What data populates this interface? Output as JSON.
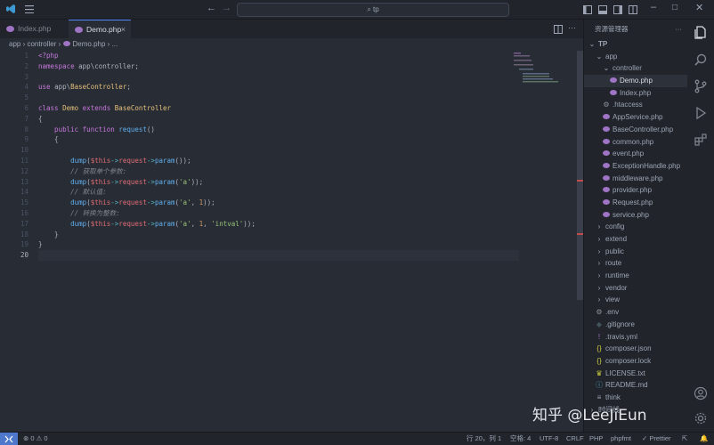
{
  "colors": {
    "keyword": "#c678dd",
    "function": "#61afef",
    "class": "#e5c07b",
    "variable": "#e06c75",
    "string": "#98c379",
    "number": "#d19a66",
    "comment": "#7f848e",
    "operator": "#56b6c2",
    "plain": "#abb2bf",
    "accent": "#528bff",
    "php_icon": "#a074c4"
  },
  "titlebar": {
    "search": "tp"
  },
  "tabs": [
    {
      "label": "Index.php"
    },
    {
      "label": "Demo.php",
      "close": "×"
    }
  ],
  "breadcrumb": {
    "segments": [
      "app",
      "controller",
      "Demo.php",
      "..."
    ]
  },
  "editor": {
    "line_numbers": [
      "1",
      "2",
      "3",
      "4",
      "5",
      "6",
      "7",
      "8",
      "9",
      "10",
      "11",
      "12",
      "13",
      "14",
      "15",
      "16",
      "17",
      "18",
      "19",
      "20"
    ],
    "active_line": 20,
    "lines": [
      [
        {
          "t": "<?php",
          "c": "keyword"
        }
      ],
      [
        {
          "t": "namespace ",
          "c": "keyword"
        },
        {
          "t": "app\\controller",
          "c": "plain"
        },
        {
          "t": ";",
          "c": "plain"
        }
      ],
      [],
      [
        {
          "t": "use ",
          "c": "keyword"
        },
        {
          "t": "app\\",
          "c": "plain"
        },
        {
          "t": "BaseController",
          "c": "class"
        },
        {
          "t": ";",
          "c": "plain"
        }
      ],
      [],
      [
        {
          "t": "class ",
          "c": "keyword"
        },
        {
          "t": "Demo ",
          "c": "class"
        },
        {
          "t": "extends ",
          "c": "keyword"
        },
        {
          "t": "BaseController",
          "c": "class"
        }
      ],
      [
        {
          "t": "{",
          "c": "plain"
        }
      ],
      [
        {
          "t": "    public ",
          "c": "keyword"
        },
        {
          "t": "function ",
          "c": "keyword"
        },
        {
          "t": "request",
          "c": "function"
        },
        {
          "t": "()",
          "c": "plain"
        }
      ],
      [
        {
          "t": "    {",
          "c": "plain"
        }
      ],
      [],
      [
        {
          "t": "        ",
          "c": "plain"
        },
        {
          "t": "dump",
          "c": "function"
        },
        {
          "t": "(",
          "c": "plain"
        },
        {
          "t": "$this",
          "c": "variable"
        },
        {
          "t": "->",
          "c": "operator"
        },
        {
          "t": "request",
          "c": "variable"
        },
        {
          "t": "->",
          "c": "operator"
        },
        {
          "t": "param",
          "c": "function"
        },
        {
          "t": "());",
          "c": "plain"
        }
      ],
      [
        {
          "t": "        // 获取单个参数:",
          "c": "comment"
        }
      ],
      [
        {
          "t": "        ",
          "c": "plain"
        },
        {
          "t": "dump",
          "c": "function"
        },
        {
          "t": "(",
          "c": "plain"
        },
        {
          "t": "$this",
          "c": "variable"
        },
        {
          "t": "->",
          "c": "operator"
        },
        {
          "t": "request",
          "c": "variable"
        },
        {
          "t": "->",
          "c": "operator"
        },
        {
          "t": "param",
          "c": "function"
        },
        {
          "t": "(",
          "c": "plain"
        },
        {
          "t": "'a'",
          "c": "string"
        },
        {
          "t": "));",
          "c": "plain"
        }
      ],
      [
        {
          "t": "        // 默认值:",
          "c": "comment"
        }
      ],
      [
        {
          "t": "        ",
          "c": "plain"
        },
        {
          "t": "dump",
          "c": "function"
        },
        {
          "t": "(",
          "c": "plain"
        },
        {
          "t": "$this",
          "c": "variable"
        },
        {
          "t": "->",
          "c": "operator"
        },
        {
          "t": "request",
          "c": "variable"
        },
        {
          "t": "->",
          "c": "operator"
        },
        {
          "t": "param",
          "c": "function"
        },
        {
          "t": "(",
          "c": "plain"
        },
        {
          "t": "'a'",
          "c": "string"
        },
        {
          "t": ", ",
          "c": "plain"
        },
        {
          "t": "1",
          "c": "number"
        },
        {
          "t": "));",
          "c": "plain"
        }
      ],
      [
        {
          "t": "        // 转换为整数:",
          "c": "comment"
        }
      ],
      [
        {
          "t": "        ",
          "c": "plain"
        },
        {
          "t": "dump",
          "c": "function"
        },
        {
          "t": "(",
          "c": "plain"
        },
        {
          "t": "$this",
          "c": "variable"
        },
        {
          "t": "->",
          "c": "operator"
        },
        {
          "t": "request",
          "c": "variable"
        },
        {
          "t": "->",
          "c": "operator"
        },
        {
          "t": "param",
          "c": "function"
        },
        {
          "t": "(",
          "c": "plain"
        },
        {
          "t": "'a'",
          "c": "string"
        },
        {
          "t": ", ",
          "c": "plain"
        },
        {
          "t": "1",
          "c": "number"
        },
        {
          "t": ", ",
          "c": "plain"
        },
        {
          "t": "'intval'",
          "c": "string"
        },
        {
          "t": "));",
          "c": "plain"
        }
      ],
      [
        {
          "t": "    }",
          "c": "plain"
        }
      ],
      [
        {
          "t": "}",
          "c": "plain"
        }
      ],
      []
    ]
  },
  "explorer": {
    "title": "资源管理器",
    "more": "···",
    "tree": [
      {
        "label": "TP",
        "depth": 0,
        "icon": "chevron-down",
        "bold": true
      },
      {
        "label": "app",
        "depth": 1,
        "icon": "chevron-down"
      },
      {
        "label": "controller",
        "depth": 2,
        "icon": "chevron-down"
      },
      {
        "label": "Demo.php",
        "depth": 3,
        "icon": "php",
        "selected": true
      },
      {
        "label": "Index.php",
        "depth": 3,
        "icon": "php"
      },
      {
        "label": ".htaccess",
        "depth": 2,
        "icon": "gear"
      },
      {
        "label": "AppService.php",
        "depth": 2,
        "icon": "php"
      },
      {
        "label": "BaseController.php",
        "depth": 2,
        "icon": "php"
      },
      {
        "label": "common.php",
        "depth": 2,
        "icon": "php"
      },
      {
        "label": "event.php",
        "depth": 2,
        "icon": "php"
      },
      {
        "label": "ExceptionHandle.php",
        "depth": 2,
        "icon": "php"
      },
      {
        "label": "middleware.php",
        "depth": 2,
        "icon": "php"
      },
      {
        "label": "provider.php",
        "depth": 2,
        "icon": "php"
      },
      {
        "label": "Request.php",
        "depth": 2,
        "icon": "php"
      },
      {
        "label": "service.php",
        "depth": 2,
        "icon": "php"
      },
      {
        "label": "config",
        "depth": 1,
        "icon": "chevron-right"
      },
      {
        "label": "extend",
        "depth": 1,
        "icon": "chevron-right"
      },
      {
        "label": "public",
        "depth": 1,
        "icon": "chevron-right"
      },
      {
        "label": "route",
        "depth": 1,
        "icon": "chevron-right"
      },
      {
        "label": "runtime",
        "depth": 1,
        "icon": "chevron-right"
      },
      {
        "label": "vendor",
        "depth": 1,
        "icon": "chevron-right"
      },
      {
        "label": "view",
        "depth": 1,
        "icon": "chevron-right"
      },
      {
        "label": ".env",
        "depth": 1,
        "icon": "gear"
      },
      {
        "label": ".gitignore",
        "depth": 1,
        "icon": "git"
      },
      {
        "label": ".travis.yml",
        "depth": 1,
        "icon": "yaml"
      },
      {
        "label": "composer.json",
        "depth": 1,
        "icon": "json"
      },
      {
        "label": "composer.lock",
        "depth": 1,
        "icon": "json"
      },
      {
        "label": "LICENSE.txt",
        "depth": 1,
        "icon": "license"
      },
      {
        "label": "README.md",
        "depth": 1,
        "icon": "info"
      },
      {
        "label": "think",
        "depth": 1,
        "icon": "lines"
      },
      {
        "label": "时间线",
        "depth": 0,
        "icon": "chevron-right"
      }
    ]
  },
  "statusbar": {
    "problems": "⊗ 0 ⚠ 0",
    "position": "行 20，列 1",
    "spaces": "空格: 4",
    "encoding": "UTF-8",
    "eol": "CRLF",
    "language": "PHP",
    "formatter": "phpfmt",
    "prettier": "✓ Prettier"
  },
  "watermark": "知乎 @LeeJiEun"
}
